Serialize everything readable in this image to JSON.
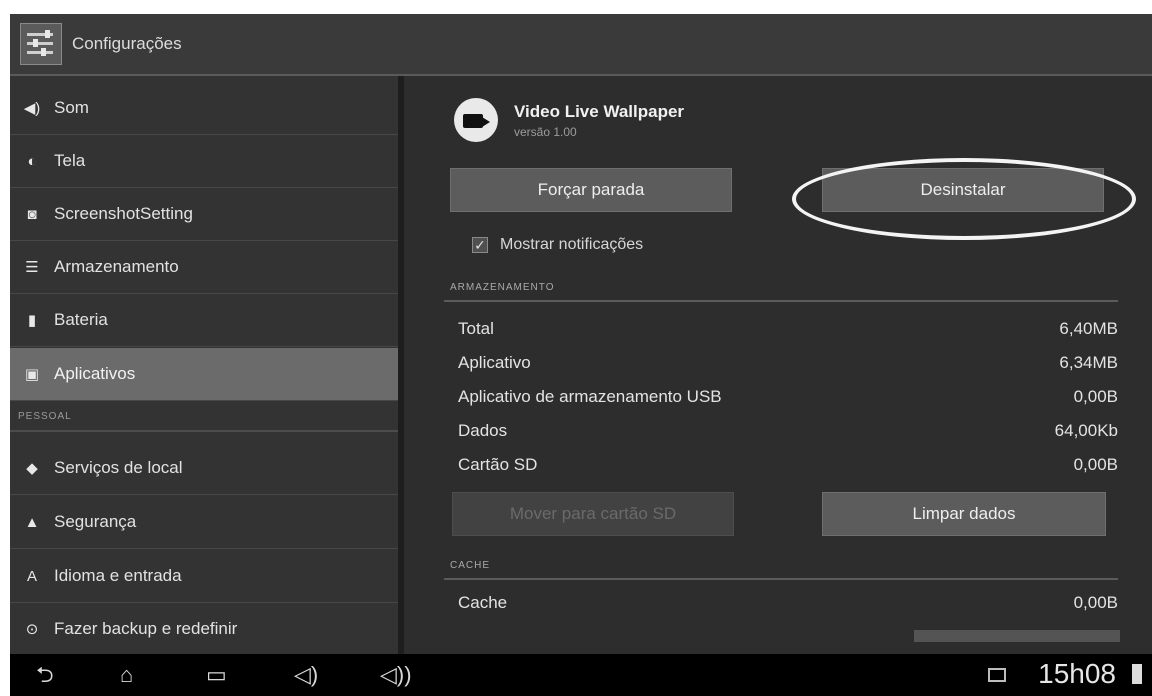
{
  "header": {
    "title": "Configurações",
    "icon": "settings-icon"
  },
  "sidebar": {
    "items": [
      {
        "label": "Som",
        "icon": "speaker-icon"
      },
      {
        "label": "Tela",
        "icon": "brightness-icon"
      },
      {
        "label": "ScreenshotSetting",
        "icon": "camera-icon"
      },
      {
        "label": "Armazenamento",
        "icon": "storage-icon"
      },
      {
        "label": "Bateria",
        "icon": "battery-icon"
      },
      {
        "label": "Aplicativos",
        "icon": "apps-icon",
        "selected": true
      }
    ],
    "section_label": "PESSOAL",
    "personal_items": [
      {
        "label": "Serviços de local",
        "icon": "location-icon"
      },
      {
        "label": "Segurança",
        "icon": "lock-icon"
      },
      {
        "label": "Idioma e entrada",
        "icon": "keyboard-icon"
      },
      {
        "label": "Fazer backup e redefinir",
        "icon": "backup-icon"
      }
    ]
  },
  "app": {
    "name": "Video Live Wallpaper",
    "version": "versão 1.00",
    "icon": "video-camera-icon",
    "force_stop_label": "Forçar parada",
    "uninstall_label": "Desinstalar",
    "notifications_label": "Mostrar notificações",
    "notifications_checked": true
  },
  "storage": {
    "section_label": "ARMAZENAMENTO",
    "rows": [
      {
        "label": "Total",
        "value": "6,40MB"
      },
      {
        "label": "Aplicativo",
        "value": "6,34MB"
      },
      {
        "label": "Aplicativo de armazenamento USB",
        "value": "0,00B"
      },
      {
        "label": "Dados",
        "value": "64,00Kb"
      },
      {
        "label": "Cartão SD",
        "value": "0,00B"
      }
    ],
    "move_label": "Mover para cartão SD",
    "clear_data_label": "Limpar dados"
  },
  "cache": {
    "section_label": "CACHE",
    "label": "Cache",
    "value": "0,00B"
  },
  "navbar": {
    "time": "15h08",
    "icons": [
      "back-icon",
      "home-icon",
      "recent-apps-icon",
      "volume-down-icon",
      "volume-up-icon"
    ]
  },
  "colors": {
    "background": "#2b2b2b",
    "selected": "#6b6b6b",
    "button": "#5c5c5c",
    "navbar": "#000000"
  }
}
